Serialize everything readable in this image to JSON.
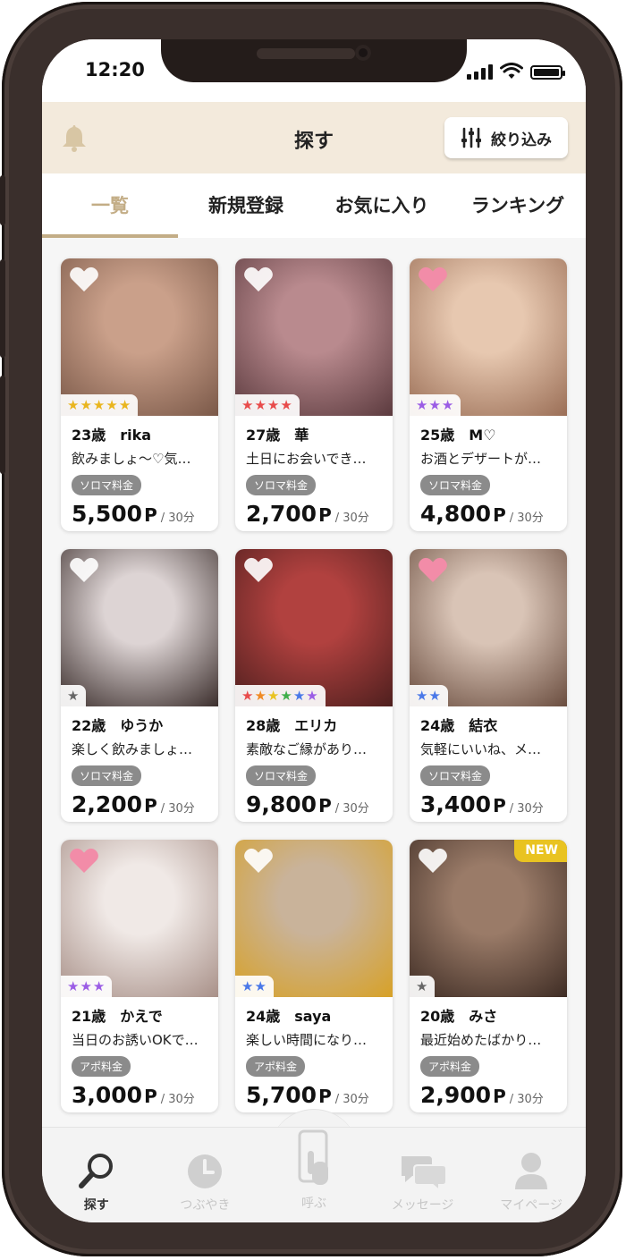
{
  "status_bar": {
    "time": "12:20"
  },
  "header": {
    "title": "探す",
    "filter_label": "絞り込み"
  },
  "tabs": [
    {
      "label": "一覧",
      "active": true
    },
    {
      "label": "新規登録",
      "active": false
    },
    {
      "label": "お気に入り",
      "active": false
    },
    {
      "label": "ランキング",
      "active": false
    }
  ],
  "cards": [
    {
      "age_name": "23歳　rika",
      "desc": "飲みましょ〜♡気…",
      "fee": "ソロマ料金",
      "price": "5,500",
      "unit": "P",
      "per": "/ 30分",
      "stars": 5,
      "star_type": "gold",
      "favorited": false,
      "is_new": false,
      "photo_colors": [
        "#caa08a",
        "#7a5848"
      ]
    },
    {
      "age_name": "27歳　華",
      "desc": "土日にお会いでき…",
      "fee": "ソロマ料金",
      "price": "2,700",
      "unit": "P",
      "per": "/ 30分",
      "stars": 4,
      "star_type": "red",
      "favorited": false,
      "is_new": false,
      "photo_colors": [
        "#b98a8e",
        "#5b3a3e"
      ]
    },
    {
      "age_name": "25歳　M♡",
      "desc": "お酒とデザートが…",
      "fee": "ソロマ料金",
      "price": "4,800",
      "unit": "P",
      "per": "/ 30分",
      "stars": 3,
      "star_type": "purple",
      "favorited": true,
      "is_new": false,
      "photo_colors": [
        "#e7c8b0",
        "#9a6e56"
      ]
    },
    {
      "age_name": "22歳　ゆうか",
      "desc": "楽しく飲みましょ…",
      "fee": "ソロマ料金",
      "price": "2,200",
      "unit": "P",
      "per": "/ 30分",
      "stars": 1,
      "star_type": "gray",
      "favorited": false,
      "is_new": false,
      "photo_colors": [
        "#ddd4d4",
        "#3b2e2c"
      ]
    },
    {
      "age_name": "28歳　エリカ",
      "desc": "素敵なご縁があり…",
      "fee": "ソロマ料金",
      "price": "9,800",
      "unit": "P",
      "per": "/ 30分",
      "stars": 6,
      "star_type": "rainbow",
      "favorited": false,
      "is_new": false,
      "photo_colors": [
        "#b1413f",
        "#4e1f1e"
      ]
    },
    {
      "age_name": "24歳　結衣",
      "desc": "気軽にいいね、メ…",
      "fee": "ソロマ料金",
      "price": "3,400",
      "unit": "P",
      "per": "/ 30分",
      "stars": 2,
      "star_type": "blue",
      "favorited": true,
      "is_new": false,
      "photo_colors": [
        "#d9c4b6",
        "#6a4d3f"
      ]
    },
    {
      "age_name": "21歳　かえで",
      "desc": "当日のお誘いOKで…",
      "fee": "アポ料金",
      "price": "3,000",
      "unit": "P",
      "per": "/ 30分",
      "stars": 3,
      "star_type": "purple",
      "favorited": true,
      "is_new": false,
      "photo_colors": [
        "#f0e9e6",
        "#a89088"
      ]
    },
    {
      "age_name": "24歳　saya",
      "desc": "楽しい時間になり…",
      "fee": "アポ料金",
      "price": "5,700",
      "unit": "P",
      "per": "/ 30分",
      "stars": 2,
      "star_type": "blue",
      "favorited": false,
      "is_new": false,
      "photo_colors": [
        "#c9b39a",
        "#d7a127"
      ]
    },
    {
      "age_name": "20歳　みさ",
      "desc": "最近始めたばかり…",
      "fee": "アポ料金",
      "price": "2,900",
      "unit": "P",
      "per": "/ 30分",
      "stars": 1,
      "star_type": "gray",
      "favorited": false,
      "is_new": true,
      "new_label": "NEW",
      "photo_colors": [
        "#9a7b68",
        "#3e2c24"
      ]
    }
  ],
  "bottom_nav": [
    {
      "label": "探す",
      "icon": "search-icon",
      "active": true
    },
    {
      "label": "つぶやき",
      "icon": "clock-icon",
      "active": false
    },
    {
      "label": "呼ぶ",
      "icon": "phone-tap-icon",
      "active": false
    },
    {
      "label": "メッセージ",
      "icon": "chat-icon",
      "active": false
    },
    {
      "label": "マイページ",
      "icon": "person-icon",
      "active": false
    }
  ],
  "colors": {
    "accent": "#c3ad86",
    "header_bg": "#f3eadc",
    "heart_on": "#f28ca8",
    "heart_off": "#ffffff",
    "new_badge": "#e9c321",
    "fee_badge": "#8b8b8b"
  }
}
